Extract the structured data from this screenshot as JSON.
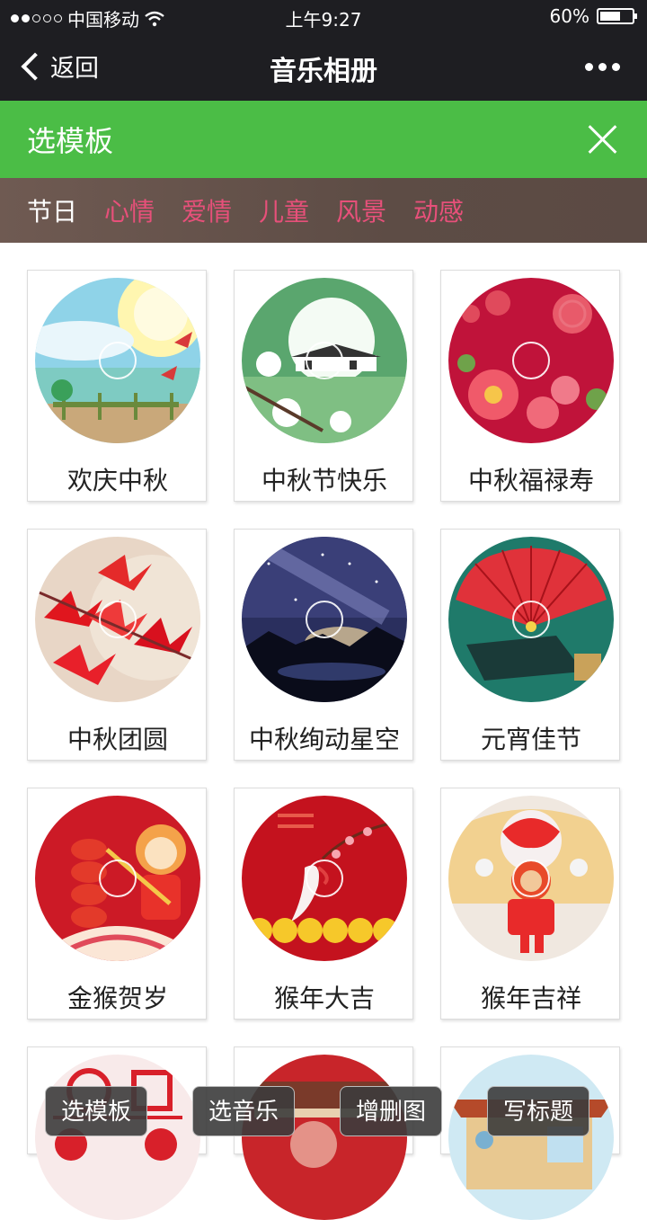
{
  "status": {
    "carrier": "中国移动",
    "time": "上午9:27",
    "battery": "60%"
  },
  "nav": {
    "back": "返回",
    "title": "音乐相册"
  },
  "panel": {
    "title": "选模板"
  },
  "categories": [
    "节日",
    "心情",
    "爱情",
    "儿童",
    "风景",
    "动感"
  ],
  "templates": [
    {
      "name": "欢庆中秋"
    },
    {
      "name": "中秋节快乐"
    },
    {
      "name": "中秋福禄寿"
    },
    {
      "name": "中秋团圆"
    },
    {
      "name": "中秋绚动星空"
    },
    {
      "name": "元宵佳节"
    },
    {
      "name": "金猴贺岁"
    },
    {
      "name": "猴年大吉"
    },
    {
      "name": "猴年吉祥"
    }
  ],
  "toolbar": {
    "template": "选模板",
    "music": "选音乐",
    "photos": "增删图",
    "caption": "写标题"
  }
}
